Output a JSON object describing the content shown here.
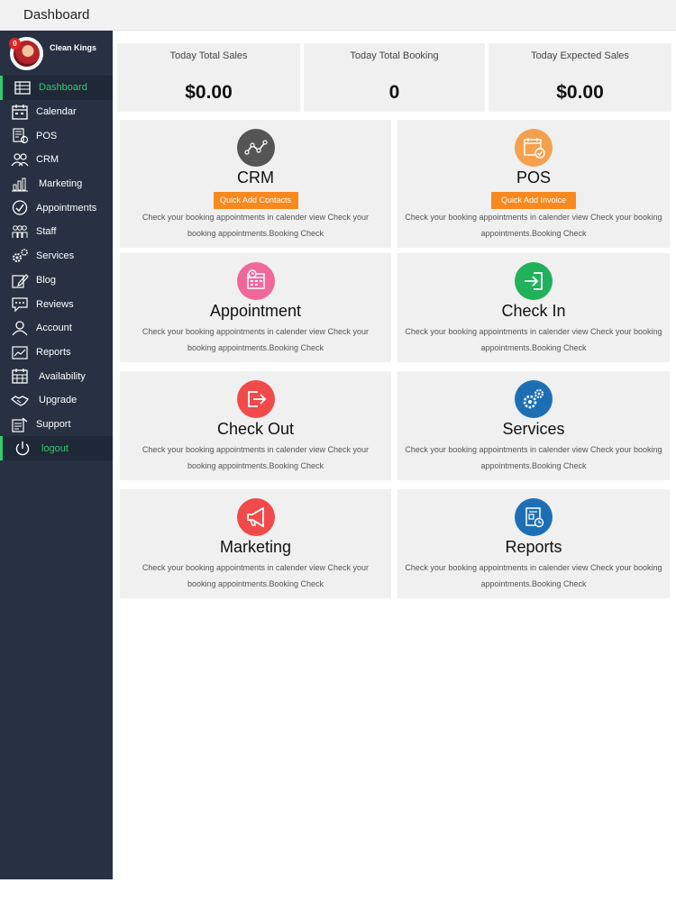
{
  "header": {
    "title": "Dashboard"
  },
  "profile": {
    "name": "Clean Kings",
    "badge": "0"
  },
  "sidebar": {
    "items": [
      {
        "label": "Dashboard",
        "icon": "table-icon"
      },
      {
        "label": "Calendar",
        "icon": "calendar-icon"
      },
      {
        "label": "POS",
        "icon": "pos-icon"
      },
      {
        "label": "CRM",
        "icon": "users-icon"
      },
      {
        "label": "Marketing",
        "icon": "bar-chart-icon"
      },
      {
        "label": "Appointments",
        "icon": "check-circle-icon"
      },
      {
        "label": "Staff",
        "icon": "staff-icon"
      },
      {
        "label": "Services",
        "icon": "gears-icon"
      },
      {
        "label": "Blog",
        "icon": "edit-icon"
      },
      {
        "label": "Reviews",
        "icon": "chat-icon"
      },
      {
        "label": "Account",
        "icon": "user-icon"
      },
      {
        "label": "Reports",
        "icon": "line-chart-icon"
      },
      {
        "label": "Availability",
        "icon": "calendar-grid-icon"
      },
      {
        "label": "Upgrade",
        "icon": "handshake-icon"
      },
      {
        "label": "Support",
        "icon": "support-icon"
      },
      {
        "label": "logout",
        "icon": "power-icon"
      }
    ]
  },
  "stats": [
    {
      "label": "Today Total Sales",
      "value": "$0.00"
    },
    {
      "label": "Today Total Booking",
      "value": "0"
    },
    {
      "label": "Today Expected Sales",
      "value": "$0.00"
    }
  ],
  "cards": [
    {
      "title": "CRM",
      "button": "Quick Add Contacts",
      "desc": "Check your booking appointments in calender view Check your booking appointments.Booking Check",
      "icon": "network-icon",
      "color": "#555555"
    },
    {
      "title": "POS",
      "button": "Quick Add Invoice",
      "desc": "Check your booking appointments in calender view Check your booking appointments.Booking Check",
      "icon": "calendar-check-icon",
      "color": "#f5a04f"
    },
    {
      "title": "Appointment",
      "desc": "Check your booking appointments in calender view Check your booking appointments.Booking Check",
      "icon": "calendar-clock-icon",
      "color": "#f0689a"
    },
    {
      "title": "Check In",
      "desc": "Check your booking appointments in calender view Check your booking appointments.Booking Check",
      "icon": "sign-in-icon",
      "color": "#20b15a"
    },
    {
      "title": "Check Out",
      "desc": "Check your booking appointments in calender view Check your booking appointments.Booking Check",
      "icon": "sign-out-icon",
      "color": "#f04a4a"
    },
    {
      "title": "Services",
      "desc": "Check your booking appointments in calender view Check your booking appointments.Booking Check",
      "icon": "gears-icon",
      "color": "#1d6fb5"
    },
    {
      "title": "Marketing",
      "desc": "Check your booking appointments in calender view Check your booking appointments.Booking Check",
      "icon": "megaphone-icon",
      "color": "#f04a4a"
    },
    {
      "title": "Reports",
      "desc": "Check your booking appointments in calender view Check your booking appointments.Booking Check",
      "icon": "report-icon",
      "color": "#1d6fb5"
    }
  ],
  "colors": {
    "sidebar": "#273142",
    "accent": "#2ecc71",
    "button": "#f7891e"
  }
}
